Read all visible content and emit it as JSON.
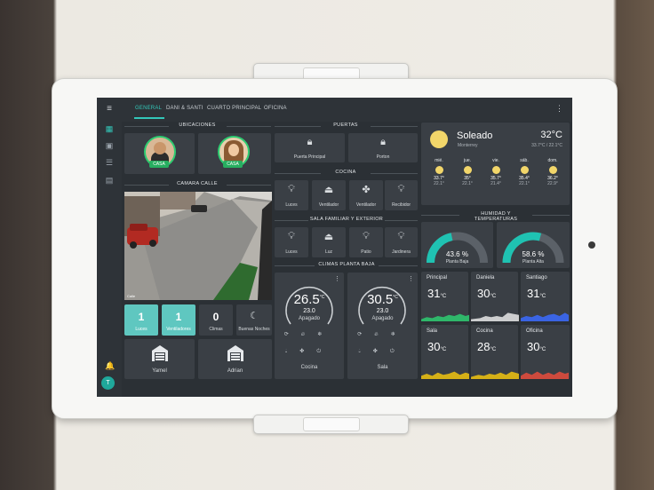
{
  "tabs": [
    "GENERAL",
    "DANI & SANTI",
    "CUARTO PRINCIPAL",
    "OFICINA"
  ],
  "sidebar_icons": [
    "menu-icon",
    "dashboard-icon",
    "id-card-icon",
    "list-icon",
    "calendar-icon",
    "bell-icon"
  ],
  "user_initial": "T",
  "ubicaciones": {
    "title": "UBICACIONES",
    "people": [
      {
        "label": "CASA"
      },
      {
        "label": "CASA"
      }
    ]
  },
  "camara": {
    "title": "CAMARA CALLE",
    "overlay": "Calle"
  },
  "quick": [
    {
      "value": "1",
      "label": "Luces"
    },
    {
      "value": "1",
      "label": "Ventiladores"
    },
    {
      "value": "0",
      "label": "Climas"
    },
    {
      "value": "",
      "label": "Buenas Noches"
    }
  ],
  "garages": [
    {
      "label": "Yamel"
    },
    {
      "label": "Adrian"
    }
  ],
  "puertas": {
    "title": "PUERTAS",
    "items": [
      {
        "label": "Puerta Principal"
      },
      {
        "label": "Porton"
      }
    ]
  },
  "cocina": {
    "title": "COCINA",
    "items": [
      {
        "label": "Luces"
      },
      {
        "label": "Ventilador"
      },
      {
        "label": "Ventilador"
      },
      {
        "label": "Recibidor"
      }
    ]
  },
  "sala": {
    "title": "SALA FAMILIAR Y EXTERIOR",
    "items": [
      {
        "label": "Luces"
      },
      {
        "label": "Luz"
      },
      {
        "label": "Patio"
      },
      {
        "label": "Jardinera"
      }
    ]
  },
  "climas": {
    "title": "CLIMAS PLANTA BAJA",
    "units": [
      {
        "current": "26.5",
        "unit": "°C",
        "target": "23.0",
        "state": "Apagado",
        "name": "Cocina"
      },
      {
        "current": "30.5",
        "unit": "°C",
        "target": "23.0",
        "state": "Apagado",
        "name": "Sala"
      }
    ]
  },
  "weather": {
    "condition": "Soleado",
    "location": "Monterrey",
    "temp": "32°C",
    "range": "33.7°C / 22.1°C",
    "days": [
      {
        "day": "mié.",
        "high": "33.7°",
        "low": "22.1°"
      },
      {
        "day": "jue.",
        "high": "35°",
        "low": "22.1°"
      },
      {
        "day": "vie.",
        "high": "35.7°",
        "low": "21.4°"
      },
      {
        "day": "sáb.",
        "high": "35.4°",
        "low": "22.1°"
      },
      {
        "day": "dom.",
        "high": "36.2°",
        "low": "22.9°"
      }
    ]
  },
  "humedad": {
    "title": "HUMIDAD Y TEMPERATURAS",
    "gauges": [
      {
        "value": "43.6 %",
        "label": "Planta Baja",
        "level": 0.436
      },
      {
        "value": "58.6 %",
        "label": "Planta Alta",
        "level": 0.586
      }
    ]
  },
  "rooms": [
    {
      "name": "Principal",
      "temp": "31",
      "unit": "°C",
      "color": "#2ecc71"
    },
    {
      "name": "Daniela",
      "temp": "30",
      "unit": "°C",
      "color": "#e8e8e8"
    },
    {
      "name": "Santiago",
      "temp": "31",
      "unit": "°C",
      "color": "#3b6bff"
    },
    {
      "name": "Sala",
      "temp": "30",
      "unit": "°C",
      "color": "#f1c40f"
    },
    {
      "name": "Cocina",
      "temp": "28",
      "unit": "°C",
      "color": "#f1c40f"
    },
    {
      "name": "Oficina",
      "temp": "30",
      "unit": "°C",
      "color": "#e74c3c"
    }
  ],
  "colors": {
    "accent": "#33c7b9",
    "panel": "#2b3035",
    "card": "#3a3f45"
  }
}
